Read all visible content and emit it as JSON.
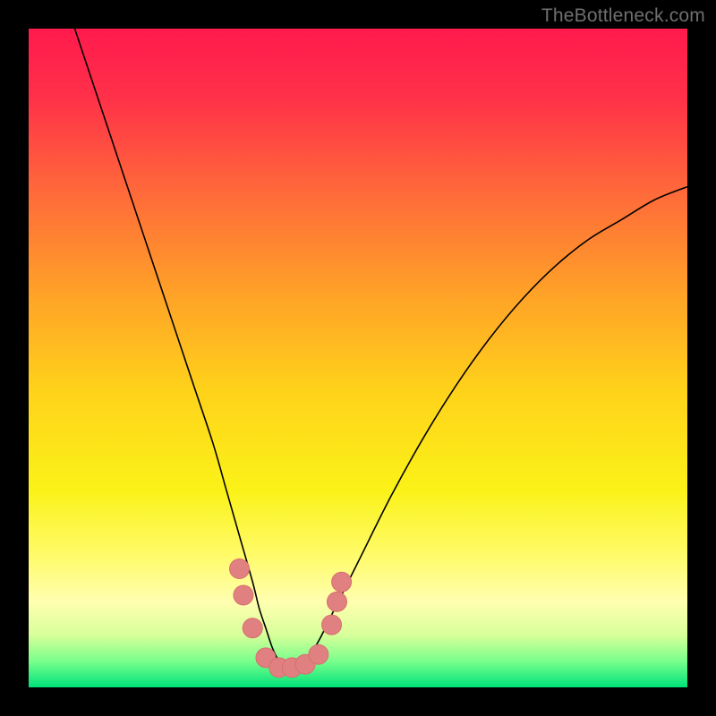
{
  "watermark": "TheBottleneck.com",
  "chart_data": {
    "type": "line",
    "title": "",
    "xlabel": "",
    "ylabel": "",
    "xlim": [
      0,
      100
    ],
    "ylim": [
      0,
      100
    ],
    "grid": false,
    "legend": false,
    "background_gradient": {
      "stops": [
        {
          "offset": 0,
          "color": "#ff1a4d"
        },
        {
          "offset": 0.1,
          "color": "#ff2f49"
        },
        {
          "offset": 0.25,
          "color": "#ff6a3a"
        },
        {
          "offset": 0.4,
          "color": "#ffa128"
        },
        {
          "offset": 0.55,
          "color": "#ffd21a"
        },
        {
          "offset": 0.7,
          "color": "#fbf218"
        },
        {
          "offset": 0.8,
          "color": "#fffb6a"
        },
        {
          "offset": 0.87,
          "color": "#ffffb0"
        },
        {
          "offset": 0.92,
          "color": "#d8ff9a"
        },
        {
          "offset": 0.96,
          "color": "#7aff8c"
        },
        {
          "offset": 1.0,
          "color": "#00e27a"
        }
      ]
    },
    "series": [
      {
        "name": "curve",
        "stroke": "#000000",
        "stroke_width": 1.6,
        "x": [
          7,
          10,
          13,
          16,
          19,
          22,
          25,
          28,
          30,
          32,
          34,
          35,
          36,
          37,
          38,
          39,
          40,
          42,
          44,
          46,
          50,
          55,
          60,
          65,
          70,
          75,
          80,
          85,
          90,
          95,
          100
        ],
        "y": [
          100,
          91,
          82,
          73,
          64,
          55,
          46,
          37,
          30,
          23,
          16,
          12,
          9,
          6,
          4,
          3,
          3,
          4,
          7,
          11,
          19,
          29,
          38,
          46,
          53,
          59,
          64,
          68,
          71,
          74,
          76
        ]
      }
    ],
    "markers": {
      "name": "lower-segment-markers",
      "fill": "#e08080",
      "stroke": "#d86f6f",
      "radius": 11,
      "points": [
        {
          "x": 32.0,
          "y": 18
        },
        {
          "x": 32.6,
          "y": 14
        },
        {
          "x": 34.0,
          "y": 9
        },
        {
          "x": 36.0,
          "y": 4.5
        },
        {
          "x": 38.0,
          "y": 3
        },
        {
          "x": 40.0,
          "y": 3
        },
        {
          "x": 42.0,
          "y": 3.5
        },
        {
          "x": 44.0,
          "y": 5
        },
        {
          "x": 46.0,
          "y": 9.5
        },
        {
          "x": 46.8,
          "y": 13
        },
        {
          "x": 47.5,
          "y": 16
        }
      ]
    }
  }
}
